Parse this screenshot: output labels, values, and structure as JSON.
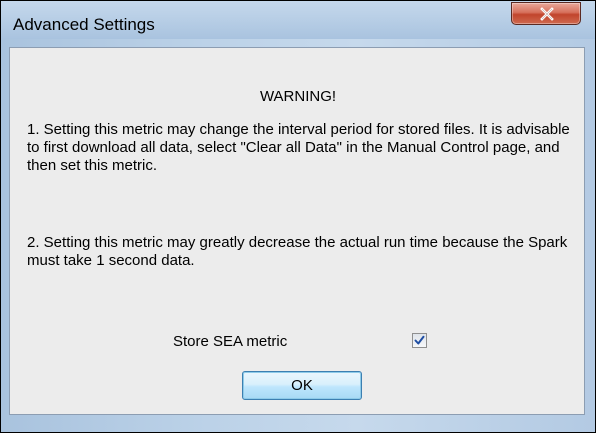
{
  "window": {
    "title": "Advanced Settings",
    "close_icon": "close-x-icon"
  },
  "content": {
    "warning_title": "WARNING!",
    "paragraph_1": "1. Setting this metric may change the interval period for stored files. It is advisable to first download all data, select \"Clear all Data\" in the Manual Control page, and then set this metric.",
    "paragraph_2": "2. Setting this metric may greatly decrease the actual run time because the Spark must take 1 second data."
  },
  "store_sea_metric": {
    "label": "Store SEA metric",
    "checked": true,
    "check_icon": "checkmark-icon"
  },
  "ok_button": {
    "label": "OK"
  },
  "colors": {
    "close_button": "#c8503a",
    "ok_button_border": "#3c7fb1",
    "dialog_background": "#ececec",
    "checkmark": "#1f4ea3"
  }
}
